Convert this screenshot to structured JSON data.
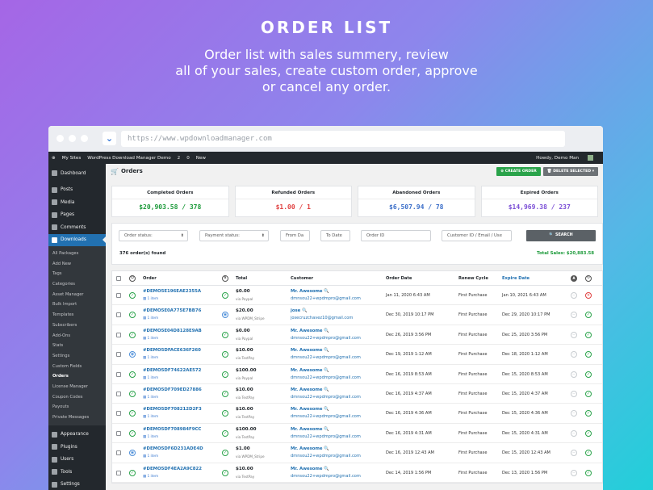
{
  "hero": {
    "title": "ORDER LIST",
    "subtitle": [
      "Order list with sales summery, review",
      "all of your sales, create custom order, approve",
      "or cancel any order."
    ]
  },
  "browser": {
    "url": "https://www.wpdownloadmanager.com"
  },
  "adminbar": {
    "items": [
      "My Sites",
      "WordPress Download Manager Demo",
      "2",
      "0",
      "New"
    ],
    "user": "Howdy, Demo Man"
  },
  "sidebar": {
    "top": [
      {
        "label": "Dashboard",
        "icon": "dashboard-icon"
      }
    ],
    "group1": [
      {
        "label": "Posts",
        "icon": "pin-icon"
      },
      {
        "label": "Media",
        "icon": "media-icon"
      },
      {
        "label": "Pages",
        "icon": "page-icon"
      },
      {
        "label": "Comments",
        "icon": "comment-icon"
      }
    ],
    "active": {
      "label": "Downloads",
      "icon": "download-icon"
    },
    "submenu": [
      "All Packages",
      "Add New",
      "Tags",
      "Categories",
      "Asset Manager",
      "Bulk Import",
      "Templates",
      "Subscribers",
      "Add-Ons",
      "Stats",
      "Settings",
      "Custom Fields",
      "Orders",
      "License Manager",
      "Coupon Codes",
      "Payouts",
      "Private Messages"
    ],
    "current_sub": "Orders",
    "bottom": [
      {
        "label": "Appearance",
        "icon": "brush-icon"
      },
      {
        "label": "Plugins",
        "icon": "plugin-icon"
      },
      {
        "label": "Users",
        "icon": "users-icon"
      },
      {
        "label": "Tools",
        "icon": "tools-icon"
      },
      {
        "label": "Settings",
        "icon": "settings-icon"
      }
    ]
  },
  "page": {
    "title": "Orders",
    "create_label": "CREATE ORDER",
    "delete_label": "DELETE SELECTED"
  },
  "summary": [
    {
      "label": "Completed Orders",
      "value": "$20,903.58 / 378",
      "color": "#1c9a3a"
    },
    {
      "label": "Refunded Orders",
      "value": "$1.00 / 1",
      "color": "#e04040"
    },
    {
      "label": "Abandoned Orders",
      "value": "$6,507.94 / 78",
      "color": "#3c6fc9"
    },
    {
      "label": "Expired Orders",
      "value": "$14,969.38 / 237",
      "color": "#7b4fd6"
    }
  ],
  "filters": {
    "order_status": "Order status:",
    "payment_status": "Payment status:",
    "from_date": "From Da",
    "to_date": "To Date",
    "order_id": "Order ID",
    "customer": "Customer ID / Email / Use",
    "search": "SEARCH"
  },
  "found": "376 order(s) found",
  "total_sales": "Total Sales: $20,883.58",
  "columns": {
    "order": "Order",
    "total": "Total",
    "customer": "Customer",
    "order_date": "Order Date",
    "renew": "Renew Cycle",
    "expire": "Expire Date"
  },
  "rows": [
    {
      "id": "#DEMO5E196EAE2355A",
      "items": "1 item",
      "amount": "$0.00",
      "via": "via Paypal",
      "cname": "Mr. Awesome",
      "cmail": "dmnsou22+wpdmpro@gmail.com",
      "date": "Jan 11, 2020 6:43 AM",
      "renew": "First Purchase",
      "expire": "Jan 10, 2021 6:43 AM",
      "status": "green",
      "pay": "green",
      "last": "red"
    },
    {
      "id": "#DEMO5E0A775E7BB76",
      "items": "1 item",
      "amount": "$20.00",
      "via": "via WPDM_Stripe",
      "cname": "jose",
      "cmail": "josecruzchavez10@gmail.com",
      "date": "Dec 30, 2019 10:17 PM",
      "renew": "First Purchase",
      "expire": "Dec 29, 2020 10:17 PM",
      "status": "green",
      "pay": "blue",
      "last": "green"
    },
    {
      "id": "#DEMO5E04D8128E9AB",
      "items": "1 item",
      "amount": "$0.00",
      "via": "via Paypal",
      "cname": "Mr. Awesome",
      "cmail": "dmnsou22+wpdmpro@gmail.com",
      "date": "Dec 26, 2019 3:56 PM",
      "renew": "First Purchase",
      "expire": "Dec 25, 2020 3:56 PM",
      "status": "green",
      "pay": "green",
      "last": "green"
    },
    {
      "id": "#DEMO5DFACE636F260",
      "items": "1 item",
      "amount": "$10.00",
      "via": "via TestPay",
      "cname": "Mr. Awesome",
      "cmail": "dmnsou22+wpdmpro@gmail.com",
      "date": "Dec 19, 2019 1:12 AM",
      "renew": "First Purchase",
      "expire": "Dec 18, 2020 1:12 AM",
      "status": "blue",
      "pay": "green",
      "last": "green"
    },
    {
      "id": "#DEMO5DF74622AE572",
      "items": "1 item",
      "amount": "$100.00",
      "via": "via Paypal",
      "cname": "Mr. Awesome",
      "cmail": "dmnsou22+wpdmpro@gmail.com",
      "date": "Dec 16, 2019 8:53 AM",
      "renew": "First Purchase",
      "expire": "Dec 15, 2020 8:53 AM",
      "status": "green",
      "pay": "green",
      "last": "green"
    },
    {
      "id": "#DEMO5DF709ED27886",
      "items": "1 item",
      "amount": "$10.00",
      "via": "via TestPay",
      "cname": "Mr. Awesome",
      "cmail": "dmnsou22+wpdmpro@gmail.com",
      "date": "Dec 16, 2019 4:37 AM",
      "renew": "First Purchase",
      "expire": "Dec 15, 2020 4:37 AM",
      "status": "green",
      "pay": "green",
      "last": "green"
    },
    {
      "id": "#DEMO5DF708212D2F3",
      "items": "1 item",
      "amount": "$10.00",
      "via": "via TestPay",
      "cname": "Mr. Awesome",
      "cmail": "dmnsou22+wpdmpro@gmail.com",
      "date": "Dec 16, 2019 4:36 AM",
      "renew": "First Purchase",
      "expire": "Dec 15, 2020 4:36 AM",
      "status": "green",
      "pay": "green",
      "last": "green"
    },
    {
      "id": "#DEMO5DF708984F9CC",
      "items": "1 item",
      "amount": "$100.00",
      "via": "via TestPay",
      "cname": "Mr. Awesome",
      "cmail": "dmnsou22+wpdmpro@gmail.com",
      "date": "Dec 16, 2019 4:31 AM",
      "renew": "First Purchase",
      "expire": "Dec 15, 2020 4:31 AM",
      "status": "green",
      "pay": "green",
      "last": "green"
    },
    {
      "id": "#DEMO5DF6D231ADE4D",
      "items": "1 item",
      "amount": "$1.00",
      "via": "via WPDM_Stripe",
      "cname": "Mr. Awesome",
      "cmail": "dmnsou22+wpdmpro@gmail.com",
      "date": "Dec 16, 2019 12:43 AM",
      "renew": "First Purchase",
      "expire": "Dec 15, 2020 12:43 AM",
      "status": "blue",
      "pay": "green",
      "last": "green"
    },
    {
      "id": "#DEMO5DF4EA2A9C822",
      "items": "1 item",
      "amount": "$10.00",
      "via": "via TestPay",
      "cname": "Mr. Awesome",
      "cmail": "dmnsou22+wpdmpro@gmail.com",
      "date": "Dec 14, 2019 1:56 PM",
      "renew": "First Purchase",
      "expire": "Dec 13, 2020 1:56 PM",
      "status": "green",
      "pay": "green",
      "last": "green"
    }
  ]
}
